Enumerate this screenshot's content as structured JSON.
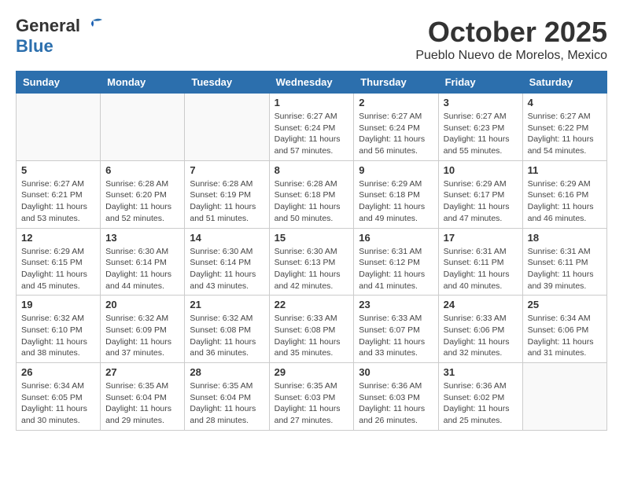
{
  "header": {
    "logo_general": "General",
    "logo_blue": "Blue",
    "month": "October 2025",
    "location": "Pueblo Nuevo de Morelos, Mexico"
  },
  "weekdays": [
    "Sunday",
    "Monday",
    "Tuesday",
    "Wednesday",
    "Thursday",
    "Friday",
    "Saturday"
  ],
  "weeks": [
    [
      {
        "day": "",
        "info": ""
      },
      {
        "day": "",
        "info": ""
      },
      {
        "day": "",
        "info": ""
      },
      {
        "day": "1",
        "info": "Sunrise: 6:27 AM\nSunset: 6:24 PM\nDaylight: 11 hours and 57 minutes."
      },
      {
        "day": "2",
        "info": "Sunrise: 6:27 AM\nSunset: 6:24 PM\nDaylight: 11 hours and 56 minutes."
      },
      {
        "day": "3",
        "info": "Sunrise: 6:27 AM\nSunset: 6:23 PM\nDaylight: 11 hours and 55 minutes."
      },
      {
        "day": "4",
        "info": "Sunrise: 6:27 AM\nSunset: 6:22 PM\nDaylight: 11 hours and 54 minutes."
      }
    ],
    [
      {
        "day": "5",
        "info": "Sunrise: 6:27 AM\nSunset: 6:21 PM\nDaylight: 11 hours and 53 minutes."
      },
      {
        "day": "6",
        "info": "Sunrise: 6:28 AM\nSunset: 6:20 PM\nDaylight: 11 hours and 52 minutes."
      },
      {
        "day": "7",
        "info": "Sunrise: 6:28 AM\nSunset: 6:19 PM\nDaylight: 11 hours and 51 minutes."
      },
      {
        "day": "8",
        "info": "Sunrise: 6:28 AM\nSunset: 6:18 PM\nDaylight: 11 hours and 50 minutes."
      },
      {
        "day": "9",
        "info": "Sunrise: 6:29 AM\nSunset: 6:18 PM\nDaylight: 11 hours and 49 minutes."
      },
      {
        "day": "10",
        "info": "Sunrise: 6:29 AM\nSunset: 6:17 PM\nDaylight: 11 hours and 47 minutes."
      },
      {
        "day": "11",
        "info": "Sunrise: 6:29 AM\nSunset: 6:16 PM\nDaylight: 11 hours and 46 minutes."
      }
    ],
    [
      {
        "day": "12",
        "info": "Sunrise: 6:29 AM\nSunset: 6:15 PM\nDaylight: 11 hours and 45 minutes."
      },
      {
        "day": "13",
        "info": "Sunrise: 6:30 AM\nSunset: 6:14 PM\nDaylight: 11 hours and 44 minutes."
      },
      {
        "day": "14",
        "info": "Sunrise: 6:30 AM\nSunset: 6:14 PM\nDaylight: 11 hours and 43 minutes."
      },
      {
        "day": "15",
        "info": "Sunrise: 6:30 AM\nSunset: 6:13 PM\nDaylight: 11 hours and 42 minutes."
      },
      {
        "day": "16",
        "info": "Sunrise: 6:31 AM\nSunset: 6:12 PM\nDaylight: 11 hours and 41 minutes."
      },
      {
        "day": "17",
        "info": "Sunrise: 6:31 AM\nSunset: 6:11 PM\nDaylight: 11 hours and 40 minutes."
      },
      {
        "day": "18",
        "info": "Sunrise: 6:31 AM\nSunset: 6:11 PM\nDaylight: 11 hours and 39 minutes."
      }
    ],
    [
      {
        "day": "19",
        "info": "Sunrise: 6:32 AM\nSunset: 6:10 PM\nDaylight: 11 hours and 38 minutes."
      },
      {
        "day": "20",
        "info": "Sunrise: 6:32 AM\nSunset: 6:09 PM\nDaylight: 11 hours and 37 minutes."
      },
      {
        "day": "21",
        "info": "Sunrise: 6:32 AM\nSunset: 6:08 PM\nDaylight: 11 hours and 36 minutes."
      },
      {
        "day": "22",
        "info": "Sunrise: 6:33 AM\nSunset: 6:08 PM\nDaylight: 11 hours and 35 minutes."
      },
      {
        "day": "23",
        "info": "Sunrise: 6:33 AM\nSunset: 6:07 PM\nDaylight: 11 hours and 33 minutes."
      },
      {
        "day": "24",
        "info": "Sunrise: 6:33 AM\nSunset: 6:06 PM\nDaylight: 11 hours and 32 minutes."
      },
      {
        "day": "25",
        "info": "Sunrise: 6:34 AM\nSunset: 6:06 PM\nDaylight: 11 hours and 31 minutes."
      }
    ],
    [
      {
        "day": "26",
        "info": "Sunrise: 6:34 AM\nSunset: 6:05 PM\nDaylight: 11 hours and 30 minutes."
      },
      {
        "day": "27",
        "info": "Sunrise: 6:35 AM\nSunset: 6:04 PM\nDaylight: 11 hours and 29 minutes."
      },
      {
        "day": "28",
        "info": "Sunrise: 6:35 AM\nSunset: 6:04 PM\nDaylight: 11 hours and 28 minutes."
      },
      {
        "day": "29",
        "info": "Sunrise: 6:35 AM\nSunset: 6:03 PM\nDaylight: 11 hours and 27 minutes."
      },
      {
        "day": "30",
        "info": "Sunrise: 6:36 AM\nSunset: 6:03 PM\nDaylight: 11 hours and 26 minutes."
      },
      {
        "day": "31",
        "info": "Sunrise: 6:36 AM\nSunset: 6:02 PM\nDaylight: 11 hours and 25 minutes."
      },
      {
        "day": "",
        "info": ""
      }
    ]
  ]
}
